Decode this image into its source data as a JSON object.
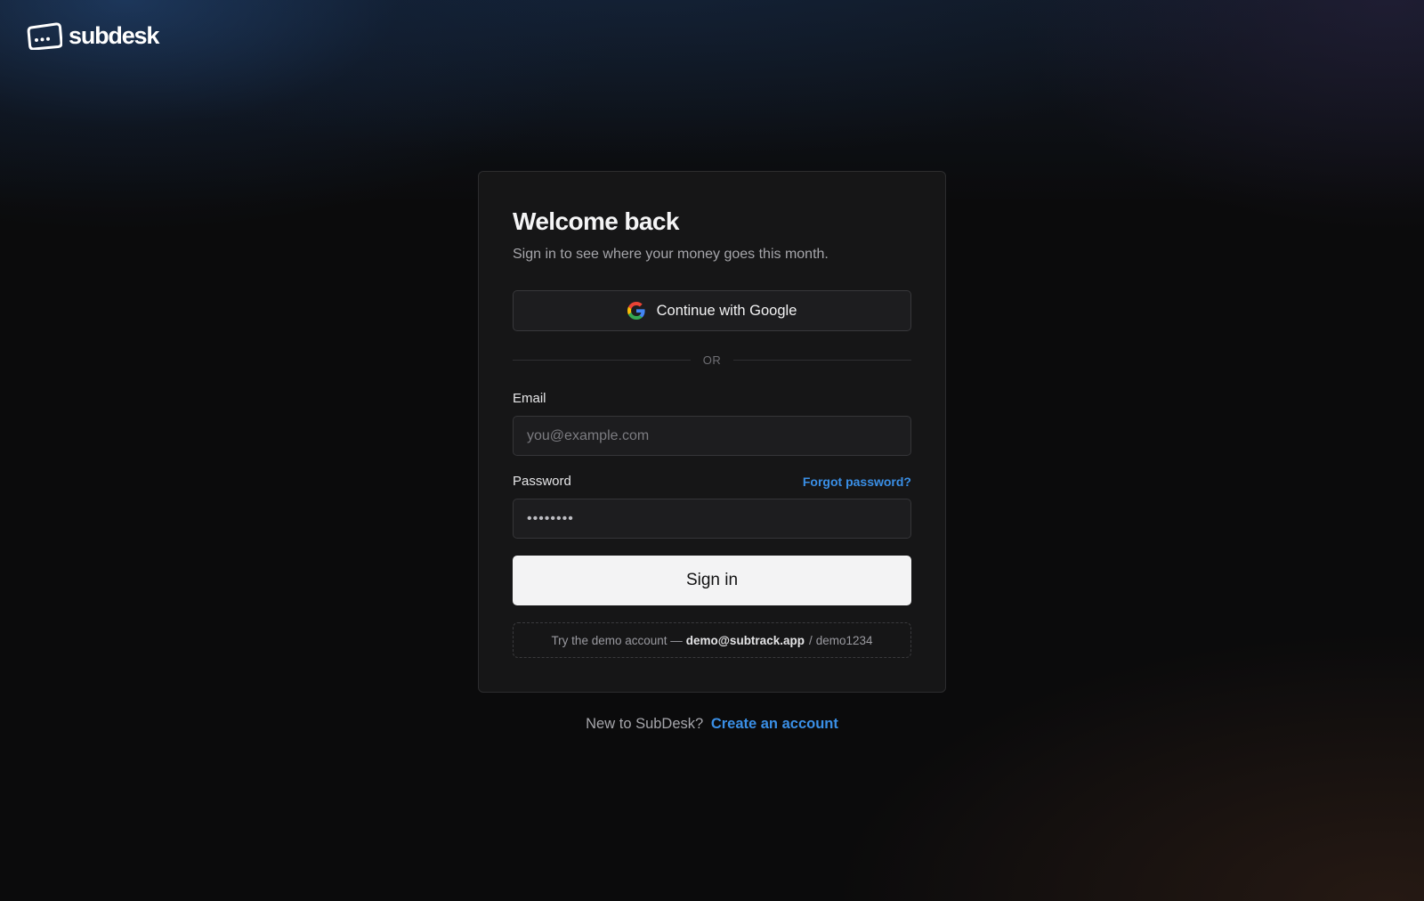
{
  "brand": {
    "name": "subdesk",
    "icon": "ticket-card-icon"
  },
  "card": {
    "title": "Welcome back",
    "subtitle": "Sign in to see where your money goes this month.",
    "google_button_label": "Continue with Google",
    "google_icon": "google-icon",
    "divider_text": "OR",
    "email_label": "Email",
    "email_placeholder": "you@example.com",
    "email_value": "",
    "password_label": "Password",
    "password_value": "••••••••",
    "forgot_password_label": "Forgot password?",
    "signin_button_label": "Sign in",
    "demo": {
      "prefix": "Try the demo account —",
      "email": "demo@subtrack.app",
      "separator": "/",
      "password": "demo1234"
    }
  },
  "footer": {
    "prompt": "New to SubDesk?",
    "create_account_label": "Create an account"
  },
  "colors": {
    "accent_link": "#3a8fe6",
    "card_background": "#161617",
    "page_background": "#0b0b0c",
    "primary_button": "#f3f3f4"
  }
}
